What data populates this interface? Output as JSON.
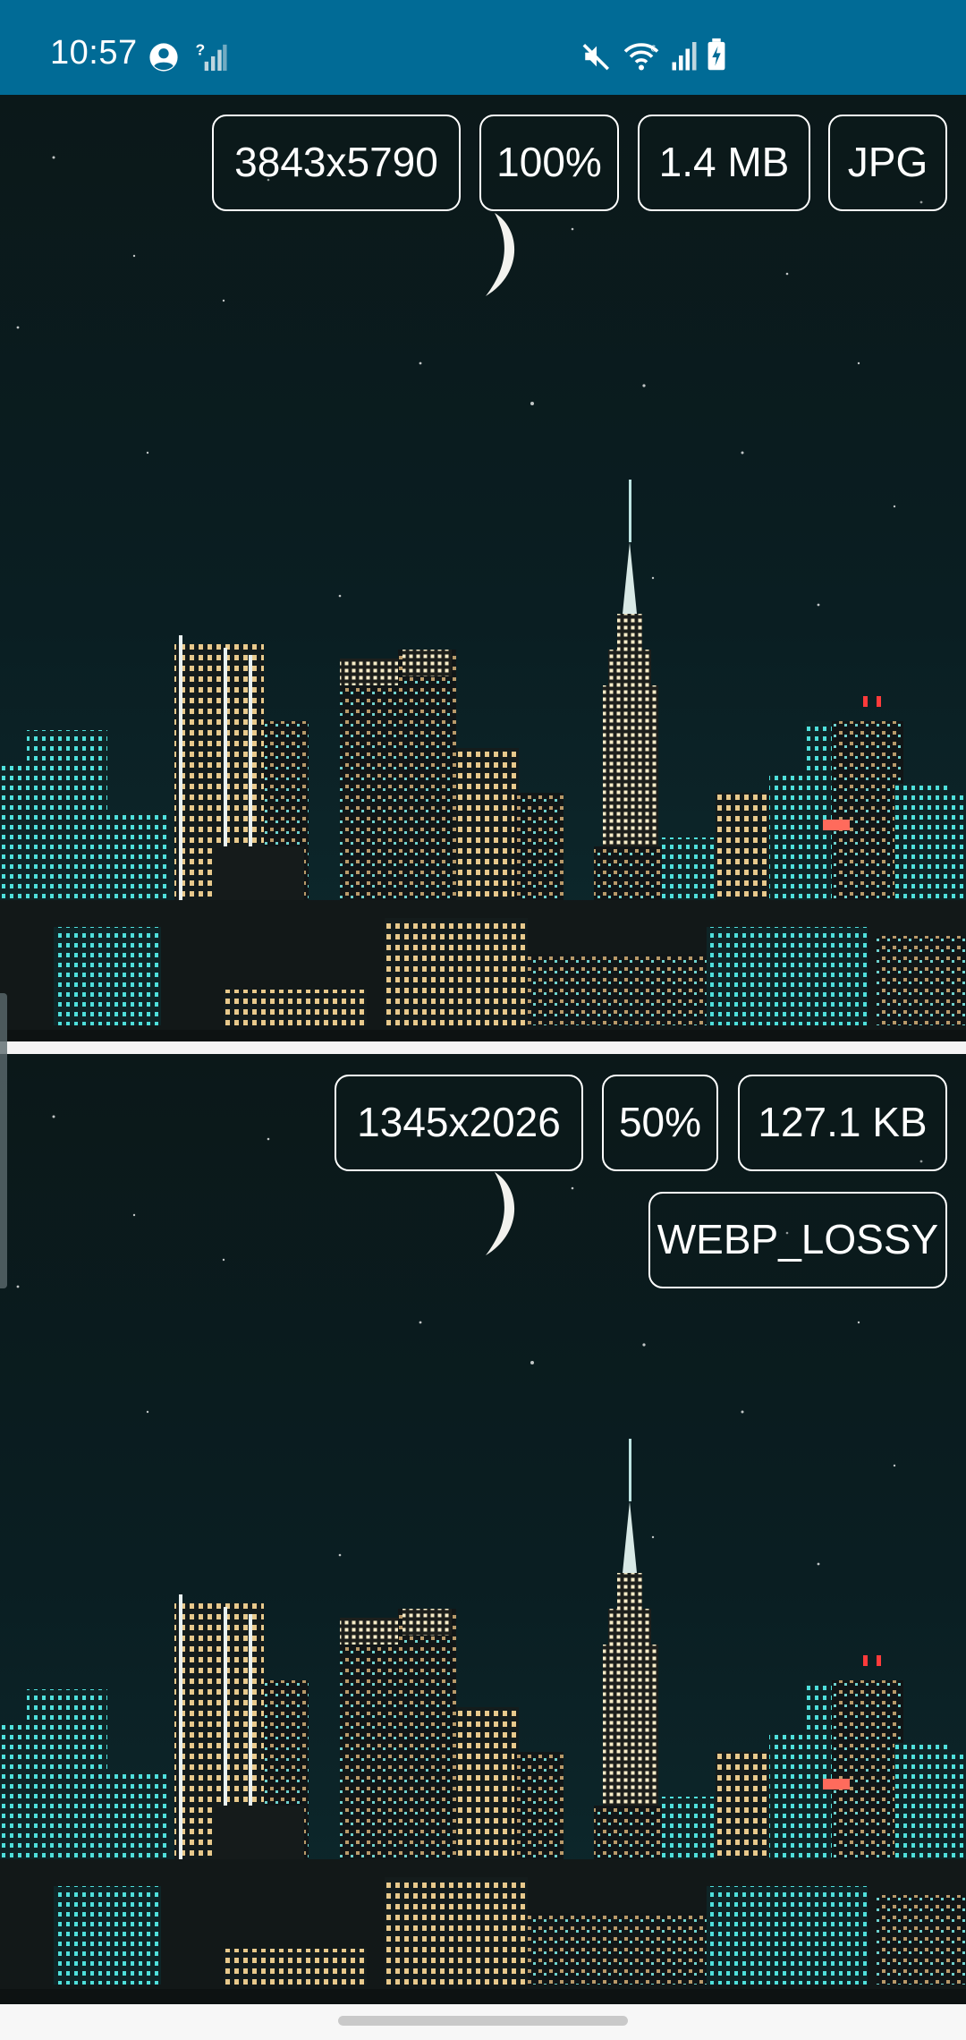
{
  "status_bar": {
    "time": "10:57",
    "background": "#016b96",
    "left_icons": [
      "account-circle-icon",
      "no-sim-signal-icon"
    ],
    "right_icons": [
      "mute-icon",
      "wifi-icon",
      "cell-signal-icon",
      "battery-charging-icon"
    ]
  },
  "top_image": {
    "resolution": "3843x5790",
    "scale": "100%",
    "file_size": "1.4 MB",
    "format": "JPG"
  },
  "bottom_image": {
    "resolution": "1345x2026",
    "scale": "50%",
    "file_size": "127.1 KB",
    "format": "WEBP_LOSSY"
  },
  "colors": {
    "sky": "#0a1a1d",
    "city_glow": "#2fd3d3",
    "badge_border": "#ffffff"
  }
}
